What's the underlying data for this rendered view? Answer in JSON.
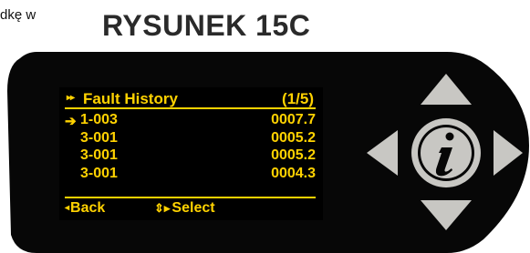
{
  "caption_fragment": "dkę w",
  "figure_title": "RYSUNEK 15C",
  "screen": {
    "header_arrows": "▸▸",
    "header_label": "Fault History",
    "header_page": "(1/5)",
    "rows": [
      {
        "pointer": "➔",
        "code": "1-003",
        "value": "0007.7"
      },
      {
        "pointer": "",
        "code": "3-001",
        "value": "0005.2"
      },
      {
        "pointer": "",
        "code": "3-001",
        "value": "0005.2"
      },
      {
        "pointer": "",
        "code": "3-001",
        "value": "0004.3"
      }
    ],
    "footer": {
      "back_icon": "◂",
      "back_label": "Back",
      "select_icon": "⇕▸",
      "select_label": "Select"
    }
  },
  "keypad": {
    "up": "arrow-up-icon",
    "down": "arrow-down-icon",
    "left": "arrow-left-icon",
    "right": "arrow-right-icon",
    "center": "info-icon",
    "button_color": "#c8c7c3"
  },
  "colors": {
    "bezel": "#070707",
    "screen_text": "#ffd200",
    "title": "#2a2a2a"
  }
}
